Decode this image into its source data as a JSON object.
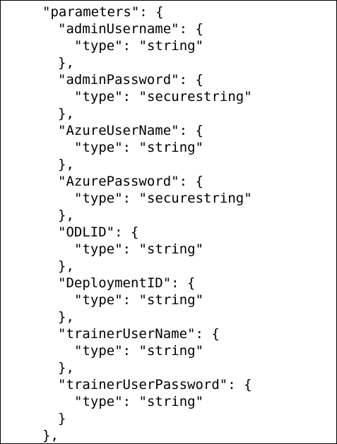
{
  "document": {
    "lines": [
      "\"parameters\": {",
      "\"adminUsername\": {",
      "\"type\": \"string\"",
      "},",
      "\"adminPassword\": {",
      "\"type\": \"securestring\"",
      "},",
      "\"AzureUserName\": {",
      "\"type\": \"string\"",
      "},",
      "\"AzurePassword\": {",
      "\"type\": \"securestring\"",
      "},",
      "\"ODLID\": {",
      "\"type\": \"string\"",
      "},",
      "\"DeploymentID\": {",
      "\"type\": \"string\"",
      "},",
      "\"trainerUserName\": {",
      "\"type\": \"string\"",
      "},",
      "\"trainerUserPassword\": {",
      "\"type\": \"string\"",
      "}",
      "},"
    ]
  }
}
